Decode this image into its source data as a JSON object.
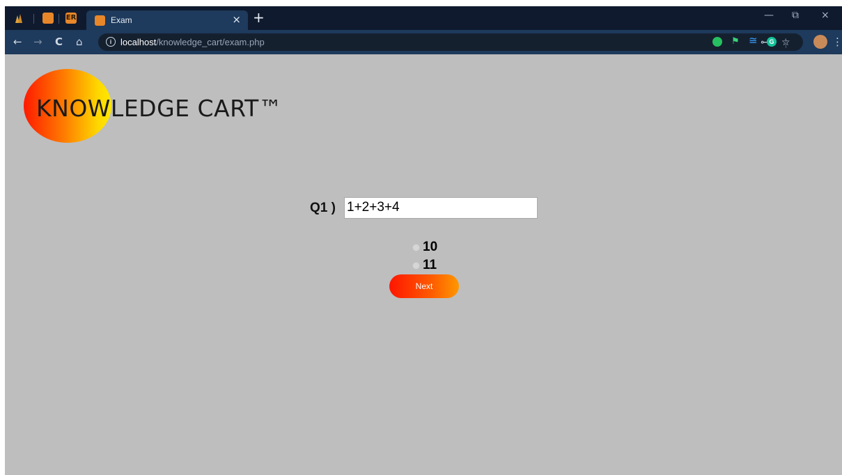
{
  "browser": {
    "tabs": [
      {
        "label": "ER",
        "pinned": true
      },
      {
        "label": "Exam",
        "active": true
      }
    ],
    "address": {
      "host": "localhost",
      "path": "/knowledge_cart/exam.php"
    },
    "extension_badge": "G",
    "icons": {
      "back": "←",
      "forward": "→",
      "reload": "C",
      "home": "⌂",
      "info": "i",
      "key": "⊶",
      "star": "☆",
      "close": "×",
      "new_tab": "+",
      "minimize": "—",
      "restore": "⧉",
      "window_close": "×",
      "menu": "⋮"
    }
  },
  "logo": {
    "text": "KNOWLEDGE CART™"
  },
  "question": {
    "label": "Q1 )",
    "text": "1+2+3+4",
    "options": [
      "10",
      "11"
    ]
  },
  "next_button": "Next",
  "colors": {
    "page_bg": "#bebebe",
    "tabbar": "#0f1a2e",
    "toolbar": "#1e3a5c",
    "accent_orange": "#ff5a00"
  }
}
